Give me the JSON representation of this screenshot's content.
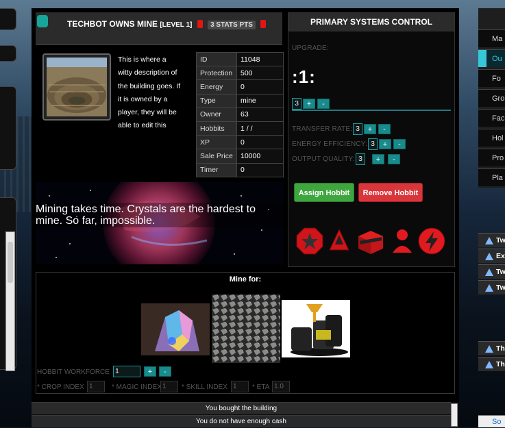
{
  "header": {
    "title": "TECHBOT OWNS MINE",
    "level": "[LEVEL 1]",
    "stat_points": "3 STATS PTS"
  },
  "description": "This is where a witty description of the building goes. If it is owned by a player, they will be able to edit this",
  "stats": [
    {
      "label": "ID",
      "value": "11048"
    },
    {
      "label": "Protection",
      "value": "500"
    },
    {
      "label": "Energy",
      "value": "0"
    },
    {
      "label": "Type",
      "value": "mine"
    },
    {
      "label": "Owner",
      "value": "63"
    },
    {
      "label": "Hobbits",
      "value": "1 / /"
    },
    {
      "label": "XP",
      "value": "0"
    },
    {
      "label": "Sale Price",
      "value": "10000"
    },
    {
      "label": "Timer",
      "value": "0"
    }
  ],
  "mining_message": "Mining takes time. Crystals are the hardest to mine. So far, impossible.",
  "control": {
    "title": "PRIMARY SYSTEMS CONTROL",
    "upgrade_label": "UPGRADE:",
    "ratio": ":1:",
    "upgrade_value": "3",
    "transfer_rate_label": "TRANSFER RATE:",
    "transfer_rate_value": "3",
    "energy_efficiency_label": "ENERGY EFFICIENCY:",
    "energy_efficiency_value": "3",
    "output_quality_label": "OUTPUT QUALITY:",
    "output_quality_value": "3",
    "plus": "+",
    "minus": "-",
    "assign_button": "Assign Hobbit",
    "remove_button": "Remove Hobbit"
  },
  "mine_for": {
    "title": "Mine for:",
    "workforce_label": "HOBBIT WORKFORCE",
    "workforce_value": "1",
    "crop_index_label": "* CROP INDEX",
    "crop_index_value": "1",
    "magic_index_label": "* MAGIC INDEX",
    "magic_index_value": "1",
    "skill_index_label": "* SKILL INDEX",
    "skill_index_value": "1",
    "eta_label": "* ETA",
    "eta_value": "1.0"
  },
  "log": [
    "You bought the building",
    "You do not have enough cash"
  ],
  "nav": [
    {
      "label": "Ma",
      "active": false
    },
    {
      "label": "Ou",
      "active": true
    },
    {
      "label": "Fo",
      "active": false
    },
    {
      "label": "Gro",
      "active": false
    },
    {
      "label": "Fac",
      "active": false
    },
    {
      "label": "Hol",
      "active": false
    },
    {
      "label": "Pro",
      "active": false
    },
    {
      "label": "Pla",
      "active": false
    }
  ],
  "tw_items": [
    "Tw",
    "Ex",
    "Tw",
    "Tw",
    "Th",
    "Th"
  ],
  "bottom_right": "So",
  "colors": {
    "teal": "#188b8c",
    "assign_green": "#3fa63f",
    "remove_red": "#d9363b",
    "nav_active": "#35c8d8"
  }
}
